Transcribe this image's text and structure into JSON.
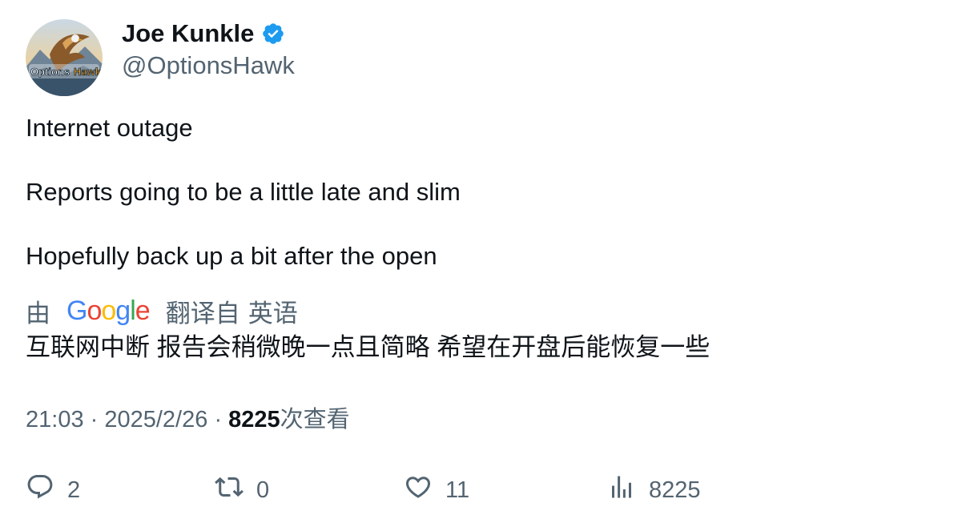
{
  "author": {
    "display_name": "Joe Kunkle",
    "handle": "@OptionsHawk",
    "verified": true,
    "avatar_logo_text": "OptionsHawk"
  },
  "tweet": {
    "paragraphs": [
      "Internet outage",
      "Reports going to be a little late and slim",
      "Hopefully back up a bit after the open"
    ],
    "translation": {
      "prefix": "由",
      "provider": "Google",
      "suffix": "翻译自",
      "language": "英语",
      "text": "互联网中断 报告会稍微晚一点且简略 希望在开盘后能恢复一些"
    }
  },
  "meta": {
    "time": "21:03",
    "separator": "·",
    "date": "2025/2/26",
    "views_count": "8225",
    "views_label": "次查看"
  },
  "actions": {
    "reply": {
      "icon": "reply-icon",
      "count": "2"
    },
    "retweet": {
      "icon": "retweet-icon",
      "count": "0"
    },
    "like": {
      "icon": "like-icon",
      "count": "11"
    },
    "views": {
      "icon": "views-icon",
      "count": "8225"
    }
  },
  "colors": {
    "text_primary": "#0f1419",
    "text_secondary": "#536471",
    "verified_blue": "#1d9bf0"
  }
}
